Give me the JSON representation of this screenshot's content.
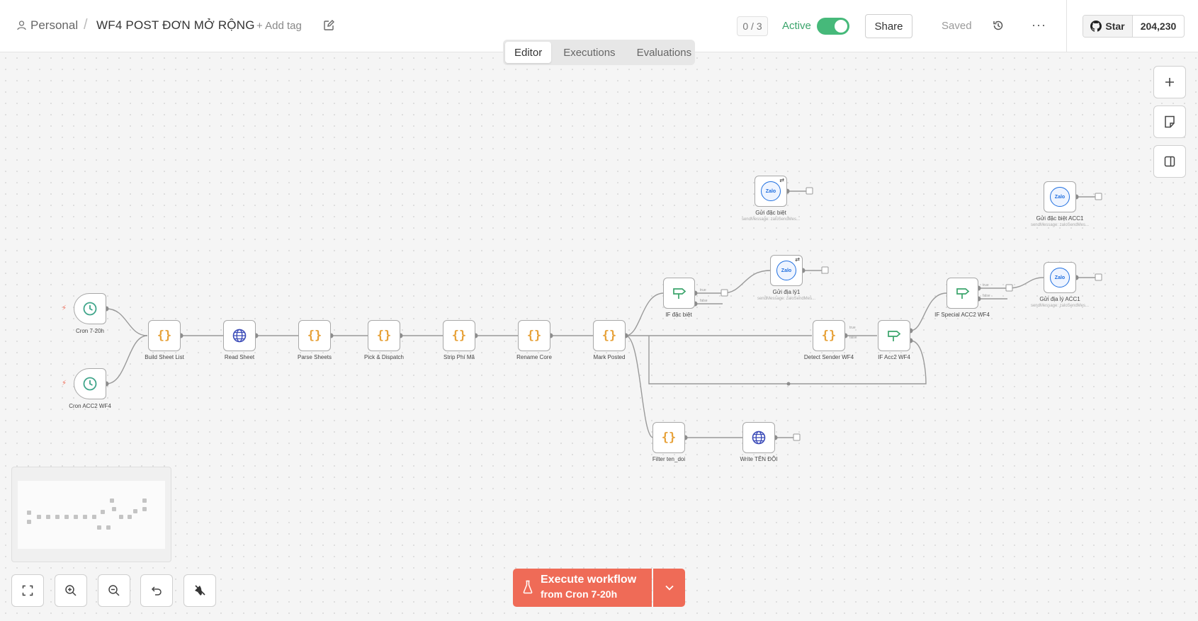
{
  "header": {
    "workspace": "Personal",
    "separator": "/",
    "workflow_title": "WF4 POST ĐƠN MỞ RỘNG",
    "add_tag": "+ Add tag",
    "progress": "0 / 3",
    "active_label": "Active",
    "active": true,
    "share_label": "Share",
    "saved_label": "Saved",
    "more": "···",
    "github_star": "Star",
    "github_count": "204,230"
  },
  "tabs": [
    {
      "label": "Editor",
      "active": true
    },
    {
      "label": "Executions",
      "active": false
    },
    {
      "label": "Evaluations",
      "active": false
    }
  ],
  "nodes": {
    "cron_7_20h": {
      "label": "Cron 7-20h",
      "icon": "clock-icon"
    },
    "cron_acc2": {
      "label": "Cron ACC2 WF4",
      "icon": "clock-icon"
    },
    "build_sheet_list": {
      "label": "Build Sheet List",
      "icon": "code-icon"
    },
    "read_sheet": {
      "label": "Read Sheet",
      "icon": "globe-icon"
    },
    "parse_sheets": {
      "label": "Parse Sheets",
      "icon": "code-icon"
    },
    "pick_dispatch": {
      "label": "Pick & Dispatch",
      "icon": "code-icon"
    },
    "strip_phi_ma": {
      "label": "Strip Phí Mã",
      "icon": "code-icon"
    },
    "rename_core": {
      "label": "Rename Core",
      "icon": "code-icon"
    },
    "mark_posted": {
      "label": "Mark Posted",
      "icon": "code-icon"
    },
    "if_dac_biet": {
      "label": "IF đặc biệt",
      "icon": "if-icon"
    },
    "gui_dac_biet": {
      "label": "Gửi đặc biệt",
      "sub": "sendMessage: zaloSendMes...",
      "icon": "zalo-icon"
    },
    "gui_dia_ly_1": {
      "label": "Gửi địa lý1",
      "sub": "sendMessage: zaloSendMes...",
      "icon": "zalo-icon"
    },
    "detect_sender": {
      "label": "Detect Sender WF4",
      "icon": "code-icon"
    },
    "if_acc2": {
      "label": "IF Acc2 WF4",
      "icon": "if-icon"
    },
    "if_special_acc2": {
      "label": "IF Special ACC2 WF4",
      "icon": "if-icon"
    },
    "gui_dac_biet_acc1": {
      "label": "Gửi đặc biệt ACC1",
      "sub": "sendMessage: zaloSendMes...",
      "icon": "zalo-icon"
    },
    "gui_dia_ly_acc1": {
      "label": "Gửi địa lý ACC1",
      "sub": "sendMessage: zaloSendMes...",
      "icon": "zalo-icon"
    },
    "filter_ten_doi": {
      "label": "Filter ten_doi",
      "icon": "code-icon"
    },
    "write_ten_doi": {
      "label": "Write TÊN ĐỘI",
      "icon": "globe-icon"
    }
  },
  "branch_labels": {
    "true": "true",
    "false": "false"
  },
  "zalo_text": "Zalo",
  "execute": {
    "title": "Execute workflow",
    "subtitle": "from Cron 7-20h"
  },
  "colors": {
    "accent": "#ef6b57",
    "active": "#46b97a",
    "code": "#e7a23a",
    "zalo": "#1f6fe0",
    "if": "#3aa46b"
  }
}
